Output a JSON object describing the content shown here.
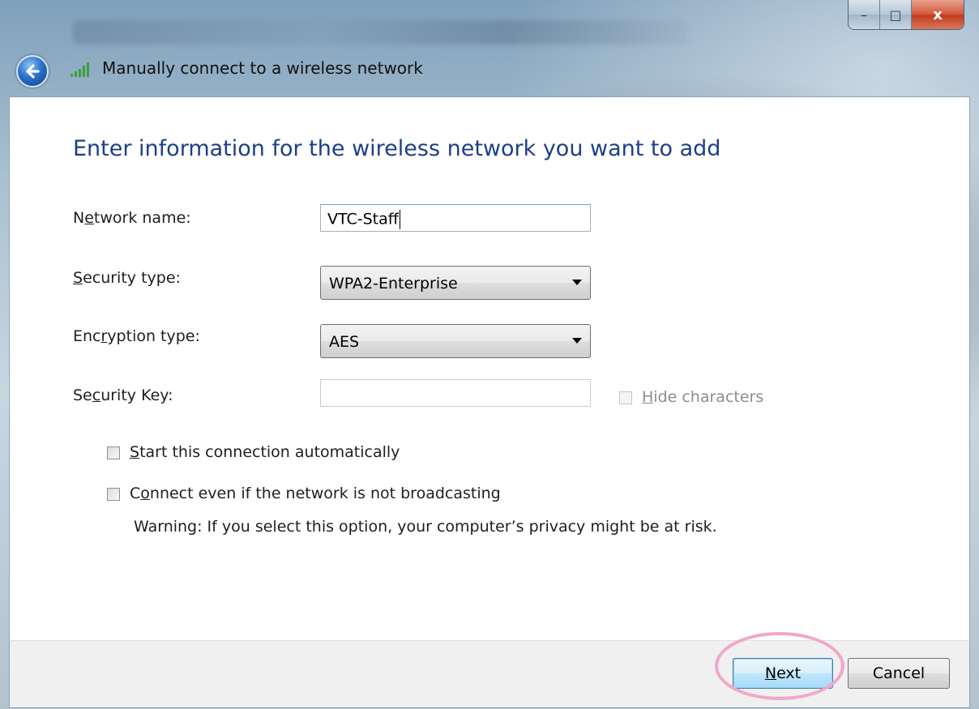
{
  "window": {
    "title": "Manually connect to a wireless network",
    "controls": {
      "minimize": "–",
      "maximize": "□",
      "close": "x"
    }
  },
  "form": {
    "heading": "Enter information for the wireless network you want to add",
    "network_name": {
      "label_pre": "N",
      "label_acc": "e",
      "label_post": "twork name:",
      "value": "VTC-Staff"
    },
    "security_type": {
      "label_pre": "",
      "label_acc": "S",
      "label_post": "ecurity type:",
      "value": "WPA2-Enterprise"
    },
    "encryption_type": {
      "label_pre": "Enc",
      "label_acc": "r",
      "label_post": "yption type:",
      "value": "AES"
    },
    "security_key": {
      "label_pre": "Se",
      "label_acc": "c",
      "label_post": "urity Key:",
      "value": ""
    },
    "hide_characters": {
      "label_pre": "",
      "label_acc": "H",
      "label_post": "ide characters",
      "checked": false,
      "enabled": false
    },
    "start_auto": {
      "label_pre": "",
      "label_acc": "S",
      "label_post": "tart this connection automatically",
      "checked": false
    },
    "connect_hidden": {
      "label_pre": "C",
      "label_acc": "o",
      "label_post": "nnect even if the network is not broadcasting",
      "checked": false
    },
    "warning": "Warning: If you select this option, your computer’s privacy might be at risk."
  },
  "footer": {
    "next": {
      "label_pre": "",
      "label_acc": "N",
      "label_post": "ext"
    },
    "cancel": "Cancel"
  },
  "colors": {
    "heading": "#1e3f88",
    "highlight_ring": "#f2a7c9",
    "signal_bars": "#3aa13a"
  },
  "icons": [
    "back-arrow-icon",
    "wireless-signal-icon",
    "chevron-down-icon"
  ]
}
